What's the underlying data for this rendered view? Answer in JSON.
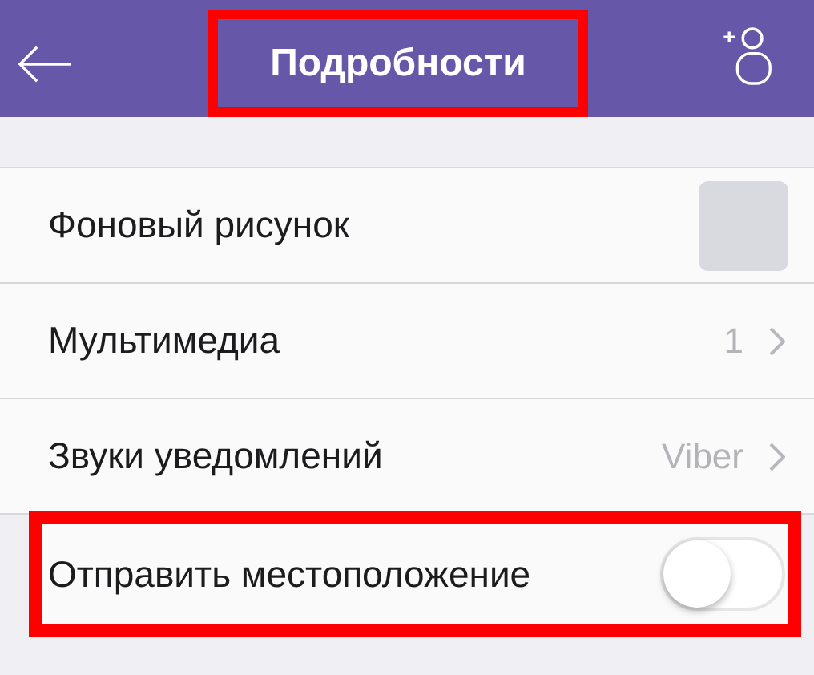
{
  "header": {
    "title": "Подробности",
    "title_highlighted": true
  },
  "rows": [
    {
      "kind": "thumbnail",
      "label": "Фоновый рисунок",
      "highlighted": false
    },
    {
      "kind": "value",
      "label": "Мультимедиа",
      "value": "1",
      "highlighted": false
    },
    {
      "kind": "value",
      "label": "Звуки уведомлений",
      "value": "Viber",
      "highlighted": false
    },
    {
      "kind": "toggle",
      "label": "Отправить местоположение",
      "on": false,
      "highlighted": true
    }
  ]
}
